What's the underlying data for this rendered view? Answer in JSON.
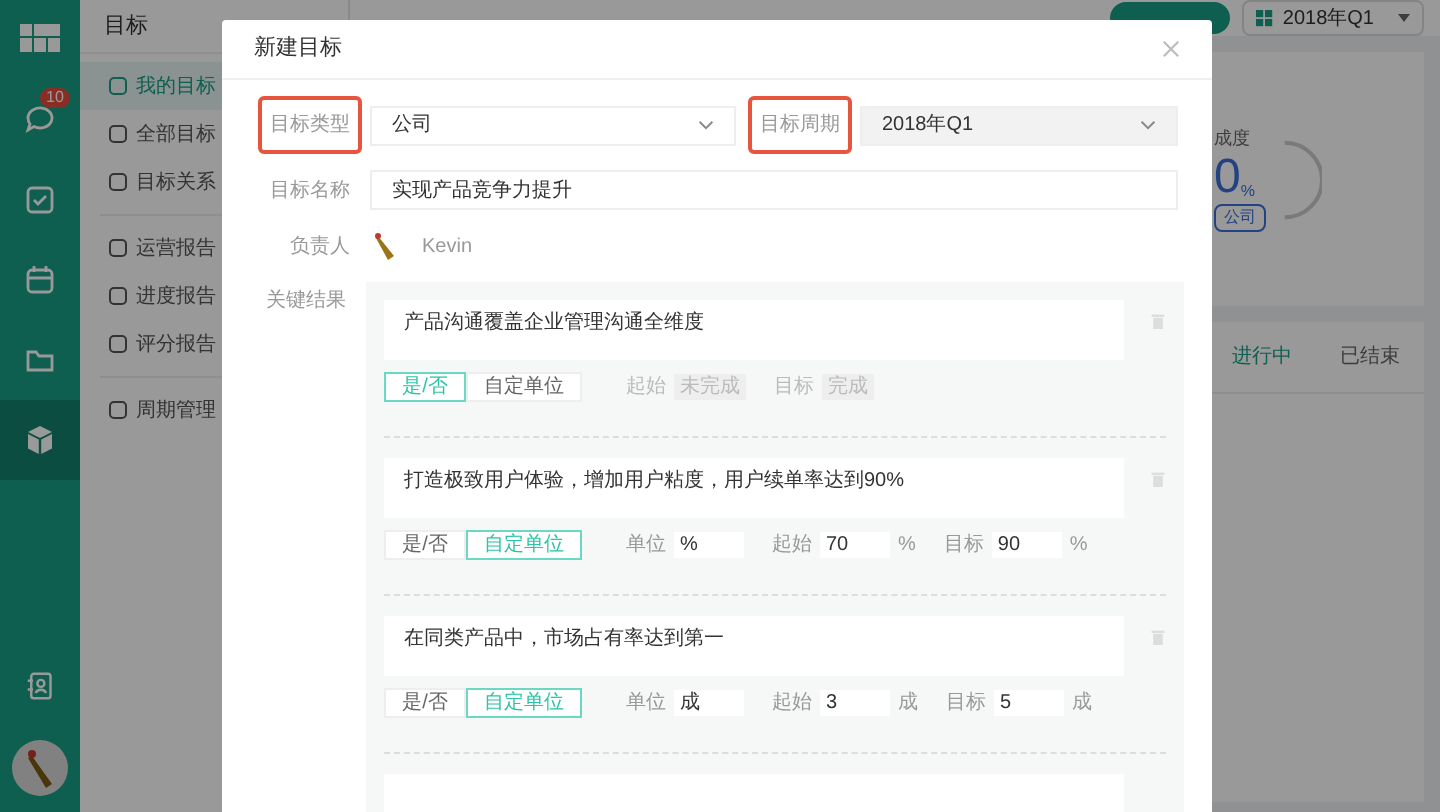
{
  "rail": {
    "badge": "10",
    "items": [
      {
        "kind": "chat",
        "selected": false
      },
      {
        "kind": "check",
        "selected": false
      },
      {
        "kind": "calendar",
        "selected": false
      },
      {
        "kind": "folder",
        "selected": false
      },
      {
        "kind": "cube",
        "selected": true
      }
    ]
  },
  "subnav": {
    "title": "目标",
    "groups": [
      [
        {
          "label": "我的目标",
          "selected": true
        },
        {
          "label": "全部目标",
          "selected": false
        },
        {
          "label": "目标关系",
          "selected": false
        }
      ],
      [
        {
          "label": "运营报告",
          "selected": false
        },
        {
          "label": "进度报告",
          "selected": false
        },
        {
          "label": "评分报告",
          "selected": false
        }
      ],
      [
        {
          "label": "周期管理",
          "selected": false
        }
      ]
    ]
  },
  "header": {
    "period": "2018年Q1"
  },
  "summary": {
    "label": "成度",
    "value": "0",
    "unit": "%",
    "tag": "公司"
  },
  "status_tabs": [
    {
      "label": "进行中",
      "selected": true
    },
    {
      "label": "已结束",
      "selected": false
    }
  ],
  "dialog": {
    "title": "新建目标",
    "type": {
      "label": "目标类型",
      "highlighted": true,
      "value": "公司"
    },
    "period": {
      "label": "目标周期",
      "highlighted": true,
      "value": "2018年Q1",
      "disabled": true
    },
    "name": {
      "label": "目标名称",
      "value": "实现产品竞争力提升"
    },
    "owner": {
      "label": "负责人",
      "name": "Kevin"
    },
    "key_results_label": "关键结果",
    "key_results": [
      {
        "text": "产品沟通覆盖企业管理沟通全维度",
        "kind": "yesno",
        "modes": [
          {
            "label": "是/否",
            "selected": true
          },
          {
            "label": "自定单位",
            "selected": false
          }
        ],
        "start_label": "起始",
        "start": "未完成",
        "target_label": "目标",
        "target": "完成"
      },
      {
        "text": "打造极致用户体验，增加用户粘度，用户续单率达到90%",
        "kind": "custom",
        "modes": [
          {
            "label": "是/否",
            "selected": false
          },
          {
            "label": "自定单位",
            "selected": true
          }
        ],
        "unit_label": "单位",
        "unit": "%",
        "start_label": "起始",
        "start": "70",
        "start_unit": "%",
        "target_label": "目标",
        "target": "90",
        "target_unit": "%"
      },
      {
        "text": "在同类产品中，市场占有率达到第一",
        "kind": "custom",
        "modes": [
          {
            "label": "是/否",
            "selected": false
          },
          {
            "label": "自定单位",
            "selected": true
          }
        ],
        "unit_label": "单位",
        "unit": "成",
        "start_label": "起始",
        "start": "3",
        "start_unit": "成",
        "target_label": "目标",
        "target": "5",
        "target_unit": "成"
      }
    ]
  }
}
